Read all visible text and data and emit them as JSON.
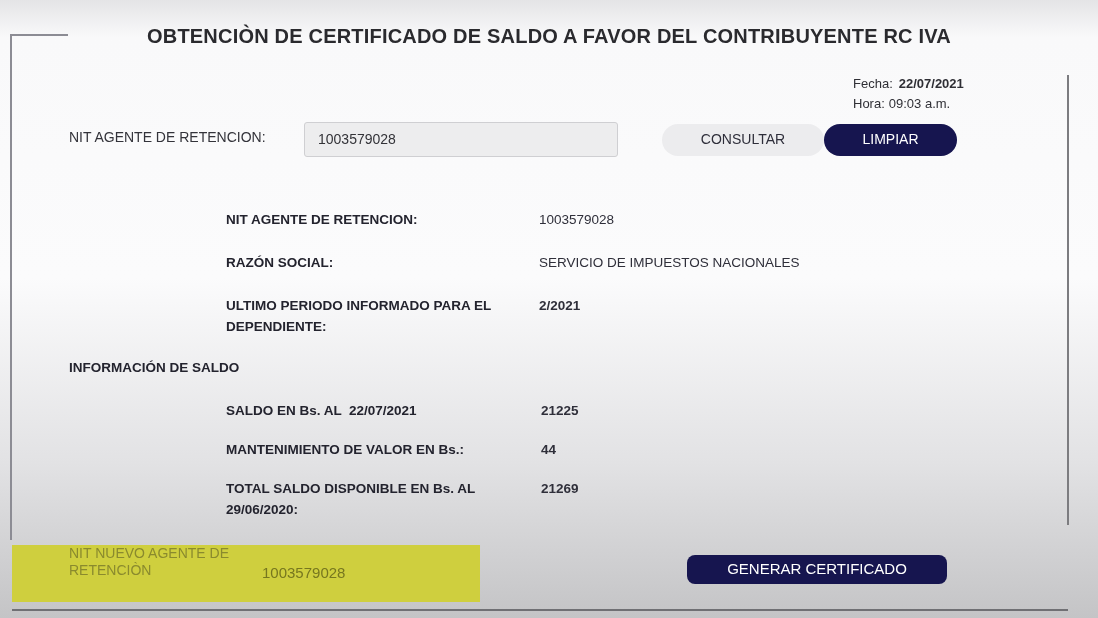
{
  "title": "OBTENCIÒN DE CERTIFICADO DE SALDO A FAVOR DEL CONTRIBUYENTE RC IVA",
  "timestamp": {
    "date_label": "Fecha:",
    "date": "22/07/2021",
    "time_label": "Hora:",
    "time": "09:03 a.m."
  },
  "search": {
    "label": "NIT AGENTE DE RETENCION:",
    "value": "1003579028",
    "buttons": [
      {
        "label": "CONSULTAR",
        "kind": "secondary"
      },
      {
        "label": "LIMPIAR",
        "kind": "primary"
      }
    ]
  },
  "agent_info": [
    {
      "label": "NIT AGENTE DE RETENCION:",
      "value": "1003579028",
      "bold": false
    },
    {
      "label": "RAZÓN SOCIAL:",
      "value": "SERVICIO DE IMPUESTOS NACIONALES",
      "bold": false
    },
    {
      "label": "ULTIMO PERIODO INFORMADO PARA EL DEPENDIENTE:",
      "value": "2/2021",
      "bold": true
    }
  ],
  "balance": {
    "heading": "INFORMACIÓN DE SALDO",
    "rows": [
      {
        "label": "SALDO EN Bs. AL  22/07/2021",
        "value": "21225",
        "bold": true
      },
      {
        "label": "MANTENIMIENTO DE VALOR EN Bs.:",
        "value": "44",
        "bold": true
      },
      {
        "label": "TOTAL SALDO DISPONIBLE EN Bs. AL 29/06/2020:",
        "value": "21269",
        "bold": true
      }
    ]
  },
  "new_agent": {
    "label": "NIT NUEVO AGENTE DE RETENCIÒN",
    "value": "1003579028",
    "highlighted": true
  },
  "actions": [
    {
      "label": "GENERAR CERTIFICADO",
      "kind": "primary"
    }
  ]
}
